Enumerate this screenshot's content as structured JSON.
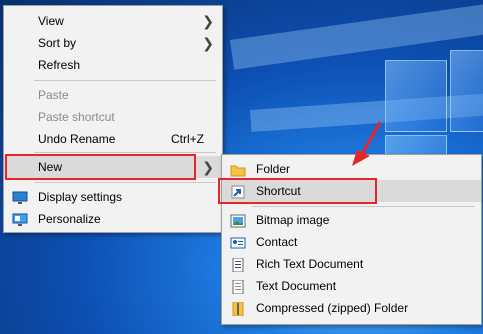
{
  "context_menu": {
    "items": [
      {
        "label": "View",
        "submenu": true
      },
      {
        "label": "Sort by",
        "submenu": true
      },
      {
        "label": "Refresh"
      },
      {
        "label": "Paste",
        "disabled": true
      },
      {
        "label": "Paste shortcut",
        "disabled": true
      },
      {
        "label": "Undo Rename",
        "shortcut": "Ctrl+Z"
      },
      {
        "label": "New",
        "submenu": true,
        "highlighted": true
      },
      {
        "label": "Display settings",
        "icon": "display-settings-icon"
      },
      {
        "label": "Personalize",
        "icon": "personalize-icon"
      }
    ]
  },
  "new_submenu": {
    "items": [
      {
        "label": "Folder",
        "icon": "folder-icon"
      },
      {
        "label": "Shortcut",
        "icon": "shortcut-icon",
        "highlighted": true
      },
      {
        "label": "Bitmap image",
        "icon": "bitmap-icon"
      },
      {
        "label": "Contact",
        "icon": "contact-icon"
      },
      {
        "label": "Rich Text Document",
        "icon": "rich-text-icon"
      },
      {
        "label": "Text Document",
        "icon": "text-document-icon"
      },
      {
        "label": "Compressed (zipped) Folder",
        "icon": "zip-folder-icon"
      }
    ]
  },
  "colors": {
    "highlight_box": "#e8262a",
    "menu_bg": "#f2f2f2",
    "desktop_blue": "#0d4fb3"
  }
}
